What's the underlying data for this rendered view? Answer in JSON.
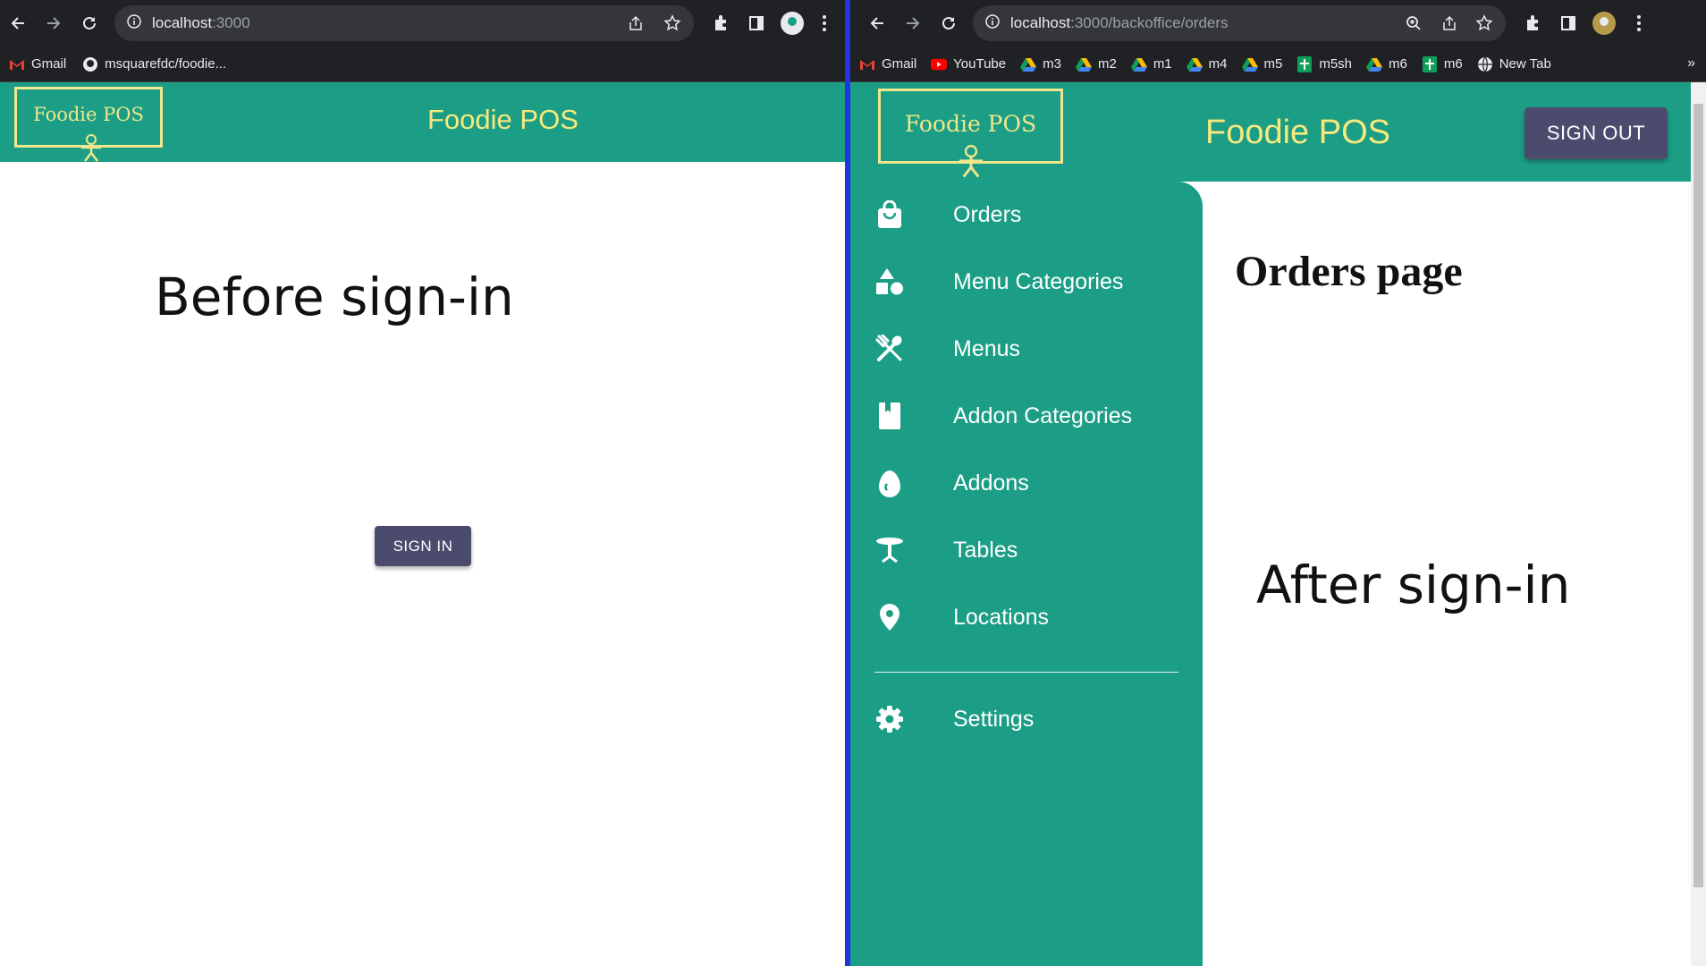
{
  "left_window": {
    "url_host": "localhost",
    "url_rest": ":3000",
    "bookmarks": [
      {
        "label": "Gmail",
        "icon": "gmail-icon"
      },
      {
        "label": "msquarefdc/foodie...",
        "icon": "github-icon"
      }
    ],
    "logo_text": "Foodie POS",
    "app_title": "Foodie POS",
    "caption": "Before sign-in",
    "sign_in_label": "SIGN IN"
  },
  "right_window": {
    "url_host": "localhost",
    "url_rest": ":3000/backoffice/orders",
    "bookmarks": [
      {
        "label": "Gmail",
        "icon": "gmail-icon"
      },
      {
        "label": "YouTube",
        "icon": "youtube-icon"
      },
      {
        "label": "m3",
        "icon": "drive-icon"
      },
      {
        "label": "m2",
        "icon": "drive-icon"
      },
      {
        "label": "m1",
        "icon": "drive-icon"
      },
      {
        "label": "m4",
        "icon": "drive-icon"
      },
      {
        "label": "m5",
        "icon": "drive-icon"
      },
      {
        "label": "m5sh",
        "icon": "sheets-icon"
      },
      {
        "label": "m6",
        "icon": "drive-icon"
      },
      {
        "label": "m6",
        "icon": "sheets-icon"
      },
      {
        "label": "New Tab",
        "icon": "globe-icon"
      }
    ],
    "logo_text": "Foodie POS",
    "app_title": "Foodie POS",
    "sign_out_label": "SIGN OUT",
    "sidebar": [
      {
        "label": "Orders",
        "icon": "shopping-bag-icon"
      },
      {
        "label": "Menu Categories",
        "icon": "shapes-icon"
      },
      {
        "label": "Menus",
        "icon": "utensils-icon"
      },
      {
        "label": "Addon Categories",
        "icon": "book-icon"
      },
      {
        "label": "Addons",
        "icon": "egg-icon"
      },
      {
        "label": "Tables",
        "icon": "table-icon"
      },
      {
        "label": "Locations",
        "icon": "location-pin-icon"
      }
    ],
    "settings_label": "Settings",
    "page_heading": "Orders page",
    "caption": "After sign-in"
  },
  "colors": {
    "appbar": "#1b9e85",
    "title_yellow": "#f7e97d",
    "button": "#4a4b6d",
    "divider": "#2234e0",
    "chrome": "#202124"
  }
}
